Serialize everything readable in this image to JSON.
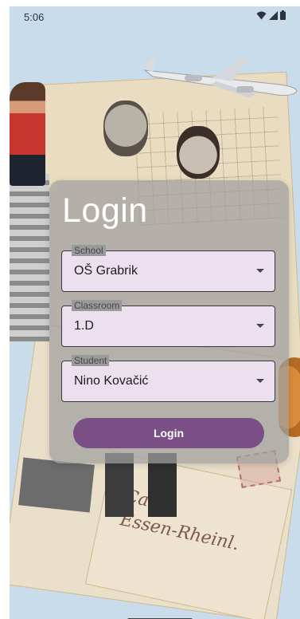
{
  "status_bar": {
    "time": "5:06"
  },
  "login": {
    "title": "Login",
    "fields": [
      {
        "label": "School",
        "value": "OŠ Grabrik"
      },
      {
        "label": "Classroom",
        "value": "1.D"
      },
      {
        "label": "Student",
        "value": "Nino Kovačić"
      }
    ],
    "button_label": "Login"
  },
  "colors": {
    "background": "#c9dceb",
    "card": "#a0a0a0",
    "field": "#ece0ee",
    "button": "#7a4f86"
  },
  "icons": [
    "wifi-icon",
    "signal-icon",
    "battery-icon",
    "dropdown-arrow-icon"
  ]
}
